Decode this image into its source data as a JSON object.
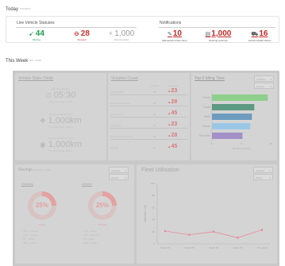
{
  "today": {
    "title": "Today",
    "subtitle": "8/10/2016",
    "live_statuses": {
      "title": "Live Vehicle Statuses",
      "items": [
        {
          "value": "44",
          "label": "Moving",
          "color": "#1e9b4d",
          "icon": "arrow-icon"
        },
        {
          "value": "28",
          "label": "Stopped",
          "color": "#d32f2f",
          "icon": "stop-icon"
        },
        {
          "value": "1,000",
          "label": "Disconnected",
          "color": "#9e9e9e",
          "icon": "plug-icon"
        }
      ]
    },
    "notifications": {
      "title": "Notifications",
      "items": [
        {
          "value": "10",
          "label": "Maintenance Due Soon",
          "icon": "wrench-icon"
        },
        {
          "value": "1,000",
          "label": "Expiring Licences",
          "icon": "licence-card-icon"
        },
        {
          "value": "16",
          "label": "Vehicle Health Issues",
          "icon": "truck-icon"
        }
      ]
    }
  },
  "this_week": {
    "title": "This Week",
    "subtitle": "8/8 - 14/08",
    "vehicle_stats": {
      "title": "Vehicle Stats (Total)",
      "items": [
        {
          "label": "Idle Time (hours)",
          "value": "05:30",
          "note": "Previous week: 04:00",
          "icon": "clock-icon"
        },
        {
          "label": "Driving Distance (km)",
          "value": "1,000km",
          "note": "Previous week: 990km",
          "icon": "road-icon"
        },
        {
          "label": "Operating Distance (km)",
          "value": "1,000km",
          "note": "Previous week: 990km",
          "icon": "gauge-icon"
        }
      ]
    },
    "violation_count": {
      "title": "Violation Count",
      "col_current": "Current",
      "col_change": "Increase",
      "rows": [
        {
          "name": "Harsh Brake",
          "current": "99",
          "delta": "23"
        },
        {
          "name": "Harsh Acceleration",
          "current": "99",
          "delta": "28"
        },
        {
          "name": "Harsh Turn",
          "current": "99",
          "delta": "45"
        },
        {
          "name": "Speeding",
          "current": "99",
          "delta": "23"
        },
        {
          "name": "Excessive Idling Time",
          "current": "99",
          "delta": "28"
        },
        {
          "name": "Mileage",
          "current": "99",
          "delta": "45"
        }
      ]
    },
    "top_idling": {
      "title": "Top 5 Idling Time",
      "dropdown1": "Vehicles",
      "dropdown2": "Drivers",
      "xlabel": "Duration (hours)",
      "chart_data": {
        "type": "bar",
        "categories": [
          "Honda",
          "Toyota",
          "BMW",
          "Nissan",
          "Mercedes"
        ],
        "values": [
          9.5,
          7.2,
          6.8,
          6.5,
          5.2
        ],
        "colors": [
          "#8ecf8c",
          "#5d9a84",
          "#6e9cc0",
          "#9bc7e6",
          "#a590c9"
        ],
        "xlim": [
          0,
          10
        ],
        "xticks": [
          "0",
          "5",
          "10"
        ]
      }
    },
    "savings": {
      "title": "Savings",
      "subtitle": "from 8/8 - 14/08",
      "dropdown1": "Vehicles",
      "dropdown2": "Drivers",
      "donuts": [
        {
          "title": "Vehicles",
          "pct": "25%",
          "caption": "Toyota",
          "lines": [
            "44% - Honda",
            "20% - Toyota",
            "8% - BMW",
            "28% - Others"
          ]
        },
        {
          "title": "Drivers",
          "pct": "25%",
          "caption": "Brandon",
          "lines": [
            "44% - Sarah",
            "20% - Brandon",
            "8% - Pete",
            "28% - Others"
          ]
        }
      ]
    },
    "fleet_utilisation": {
      "title": "Fleet Utilisation",
      "dropdown1": "Vehicles",
      "dropdown2": "Week",
      "ylabel": "Utilisation (%)",
      "chart_data": {
        "type": "line",
        "categories": [
          "Week 34",
          "Week 35",
          "Week 36",
          "Week 37",
          "This week"
        ],
        "values": [
          21,
          15,
          20,
          10,
          23
        ],
        "ylim": [
          0,
          100
        ],
        "yticks": [
          "0",
          "20",
          "40",
          "60",
          "80",
          "100"
        ],
        "color": "#e88a9b"
      }
    }
  }
}
